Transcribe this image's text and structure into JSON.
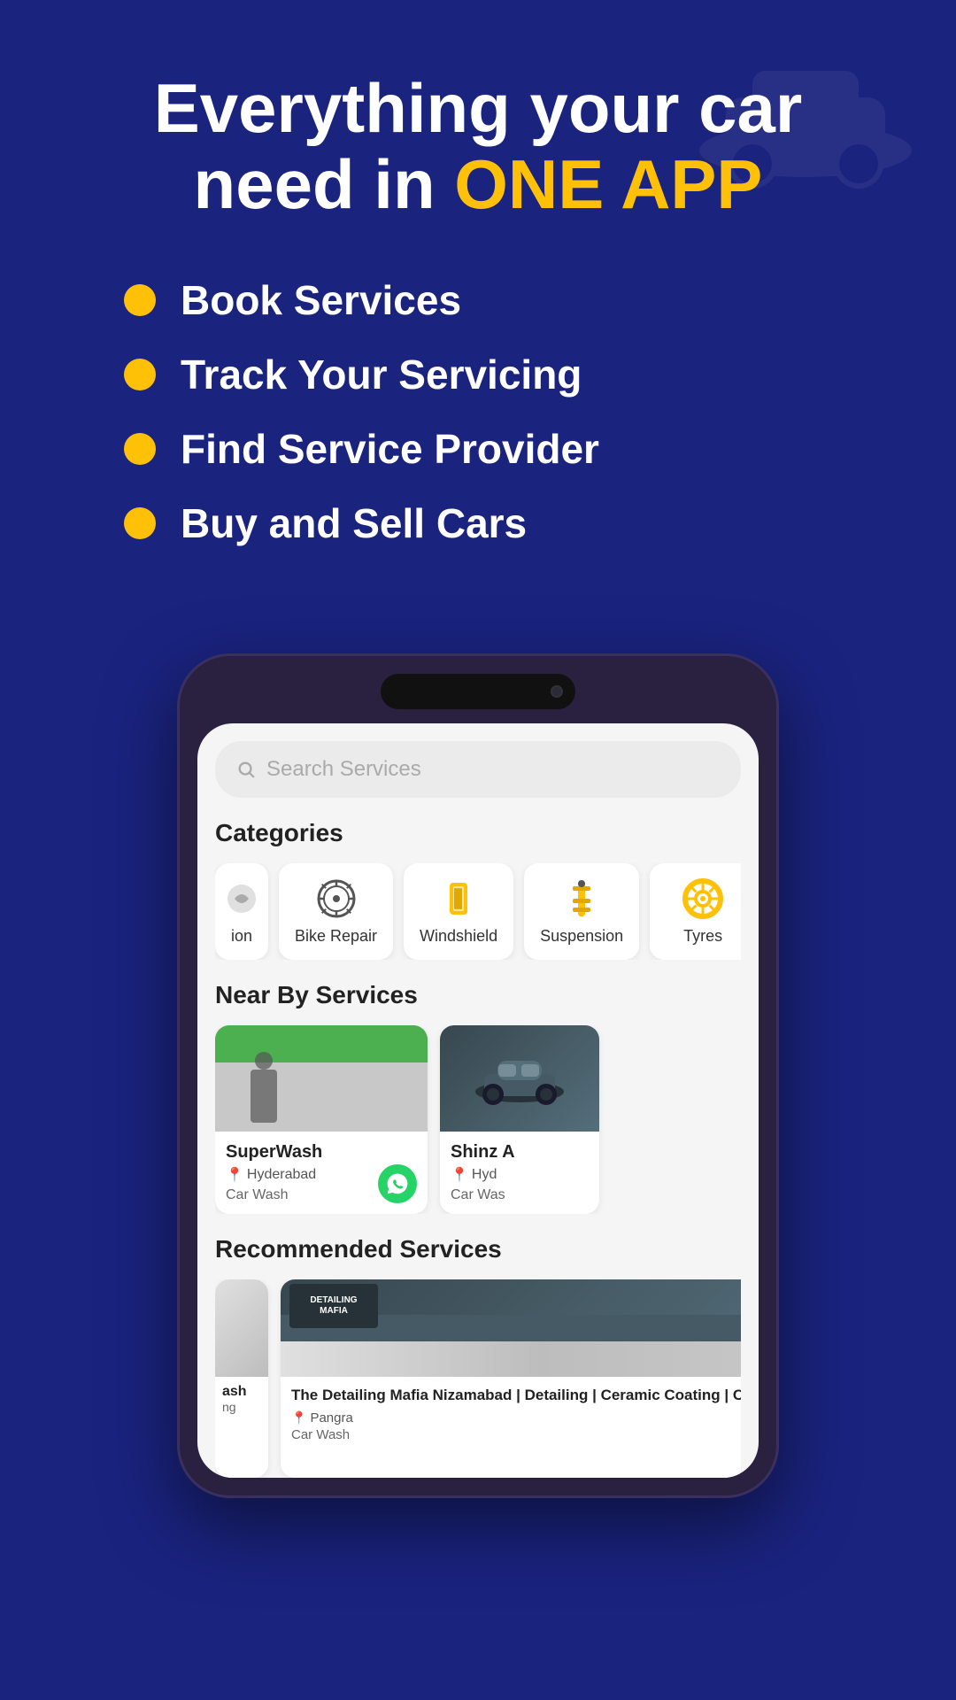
{
  "hero": {
    "title_line1": "Everything your car",
    "title_line2": "need in ",
    "title_highlight": "ONE APP"
  },
  "features": [
    {
      "id": "book",
      "text": "Book Services"
    },
    {
      "id": "track",
      "text": "Track Your Servicing"
    },
    {
      "id": "find",
      "text": "Find Service Provider"
    },
    {
      "id": "buy",
      "text": "Buy and Sell Cars"
    }
  ],
  "app": {
    "search": {
      "placeholder": "Search Services"
    },
    "categories": {
      "label": "Categories",
      "items": [
        {
          "id": "partial",
          "label": "ion",
          "icon": "partial"
        },
        {
          "id": "bike-repair",
          "label": "Bike Repair",
          "icon": "gear"
        },
        {
          "id": "windshield",
          "label": "Windshield",
          "icon": "windshield"
        },
        {
          "id": "suspension",
          "label": "Suspension",
          "icon": "suspension"
        },
        {
          "id": "tyres",
          "label": "Tyres",
          "icon": "tyre"
        }
      ]
    },
    "nearby": {
      "label": "Near By Services",
      "items": [
        {
          "id": "superwash",
          "name": "SuperWash",
          "location": "Hyderabad",
          "type": "Car Wash",
          "img_color": "#b0bec5"
        },
        {
          "id": "shinz",
          "name": "Shinz A",
          "location": "Hyd",
          "type": "Car Was",
          "img_color": "#455a64"
        }
      ]
    },
    "recommended": {
      "label": "Recommended Services",
      "items": [
        {
          "id": "partial-left",
          "name": "ash",
          "type": "ng",
          "partial": true
        },
        {
          "id": "detailing-mafia",
          "name": "The Detailing Mafia Nizamabad | Detailing | Ceramic Coating | Car PPF",
          "location": "Pangra",
          "type": "Car Wash",
          "img_color": "#37474f"
        },
        {
          "id": "partial-right",
          "partial": true,
          "img_color": "#b0bec5"
        }
      ]
    }
  },
  "colors": {
    "background": "#1a237e",
    "accent": "#FFC107",
    "white": "#ffffff",
    "phone_frame": "#2a2040",
    "screen_bg": "#f5f5f5",
    "search_bg": "#ebebeb",
    "card_bg": "#ffffff",
    "whatsapp": "#25D366",
    "location_pin": "#FFC107"
  }
}
